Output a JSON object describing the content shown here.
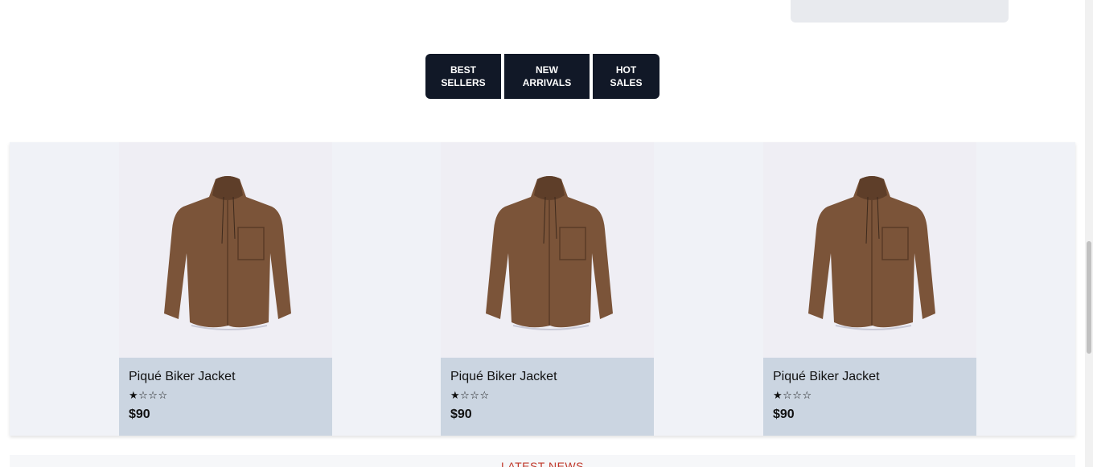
{
  "tabs": [
    {
      "label": "BEST\nSELLERS"
    },
    {
      "label": "NEW\nARRIVALS"
    },
    {
      "label": "HOT\nSALES"
    }
  ],
  "products": [
    {
      "name": "Piqué Biker Jacket",
      "rating_text": "★☆☆☆",
      "rating": 1,
      "price": "$90",
      "image_icon": "jacket-icon"
    },
    {
      "name": "Piqué Biker Jacket",
      "rating_text": "★☆☆☆",
      "rating": 1,
      "price": "$90",
      "image_icon": "jacket-icon"
    },
    {
      "name": "Piqué Biker Jacket",
      "rating_text": "★☆☆☆",
      "rating": 1,
      "price": "$90",
      "image_icon": "jacket-icon"
    }
  ],
  "news": {
    "title": "LATEST NEWS"
  },
  "colors": {
    "tab_bg": "#111827",
    "tab_text": "#ffffff",
    "card_info_bg": "#cbd5e1",
    "strip_bg": "#f0f2f7",
    "jacket": "#7b5439",
    "news_title": "#c0392b"
  }
}
